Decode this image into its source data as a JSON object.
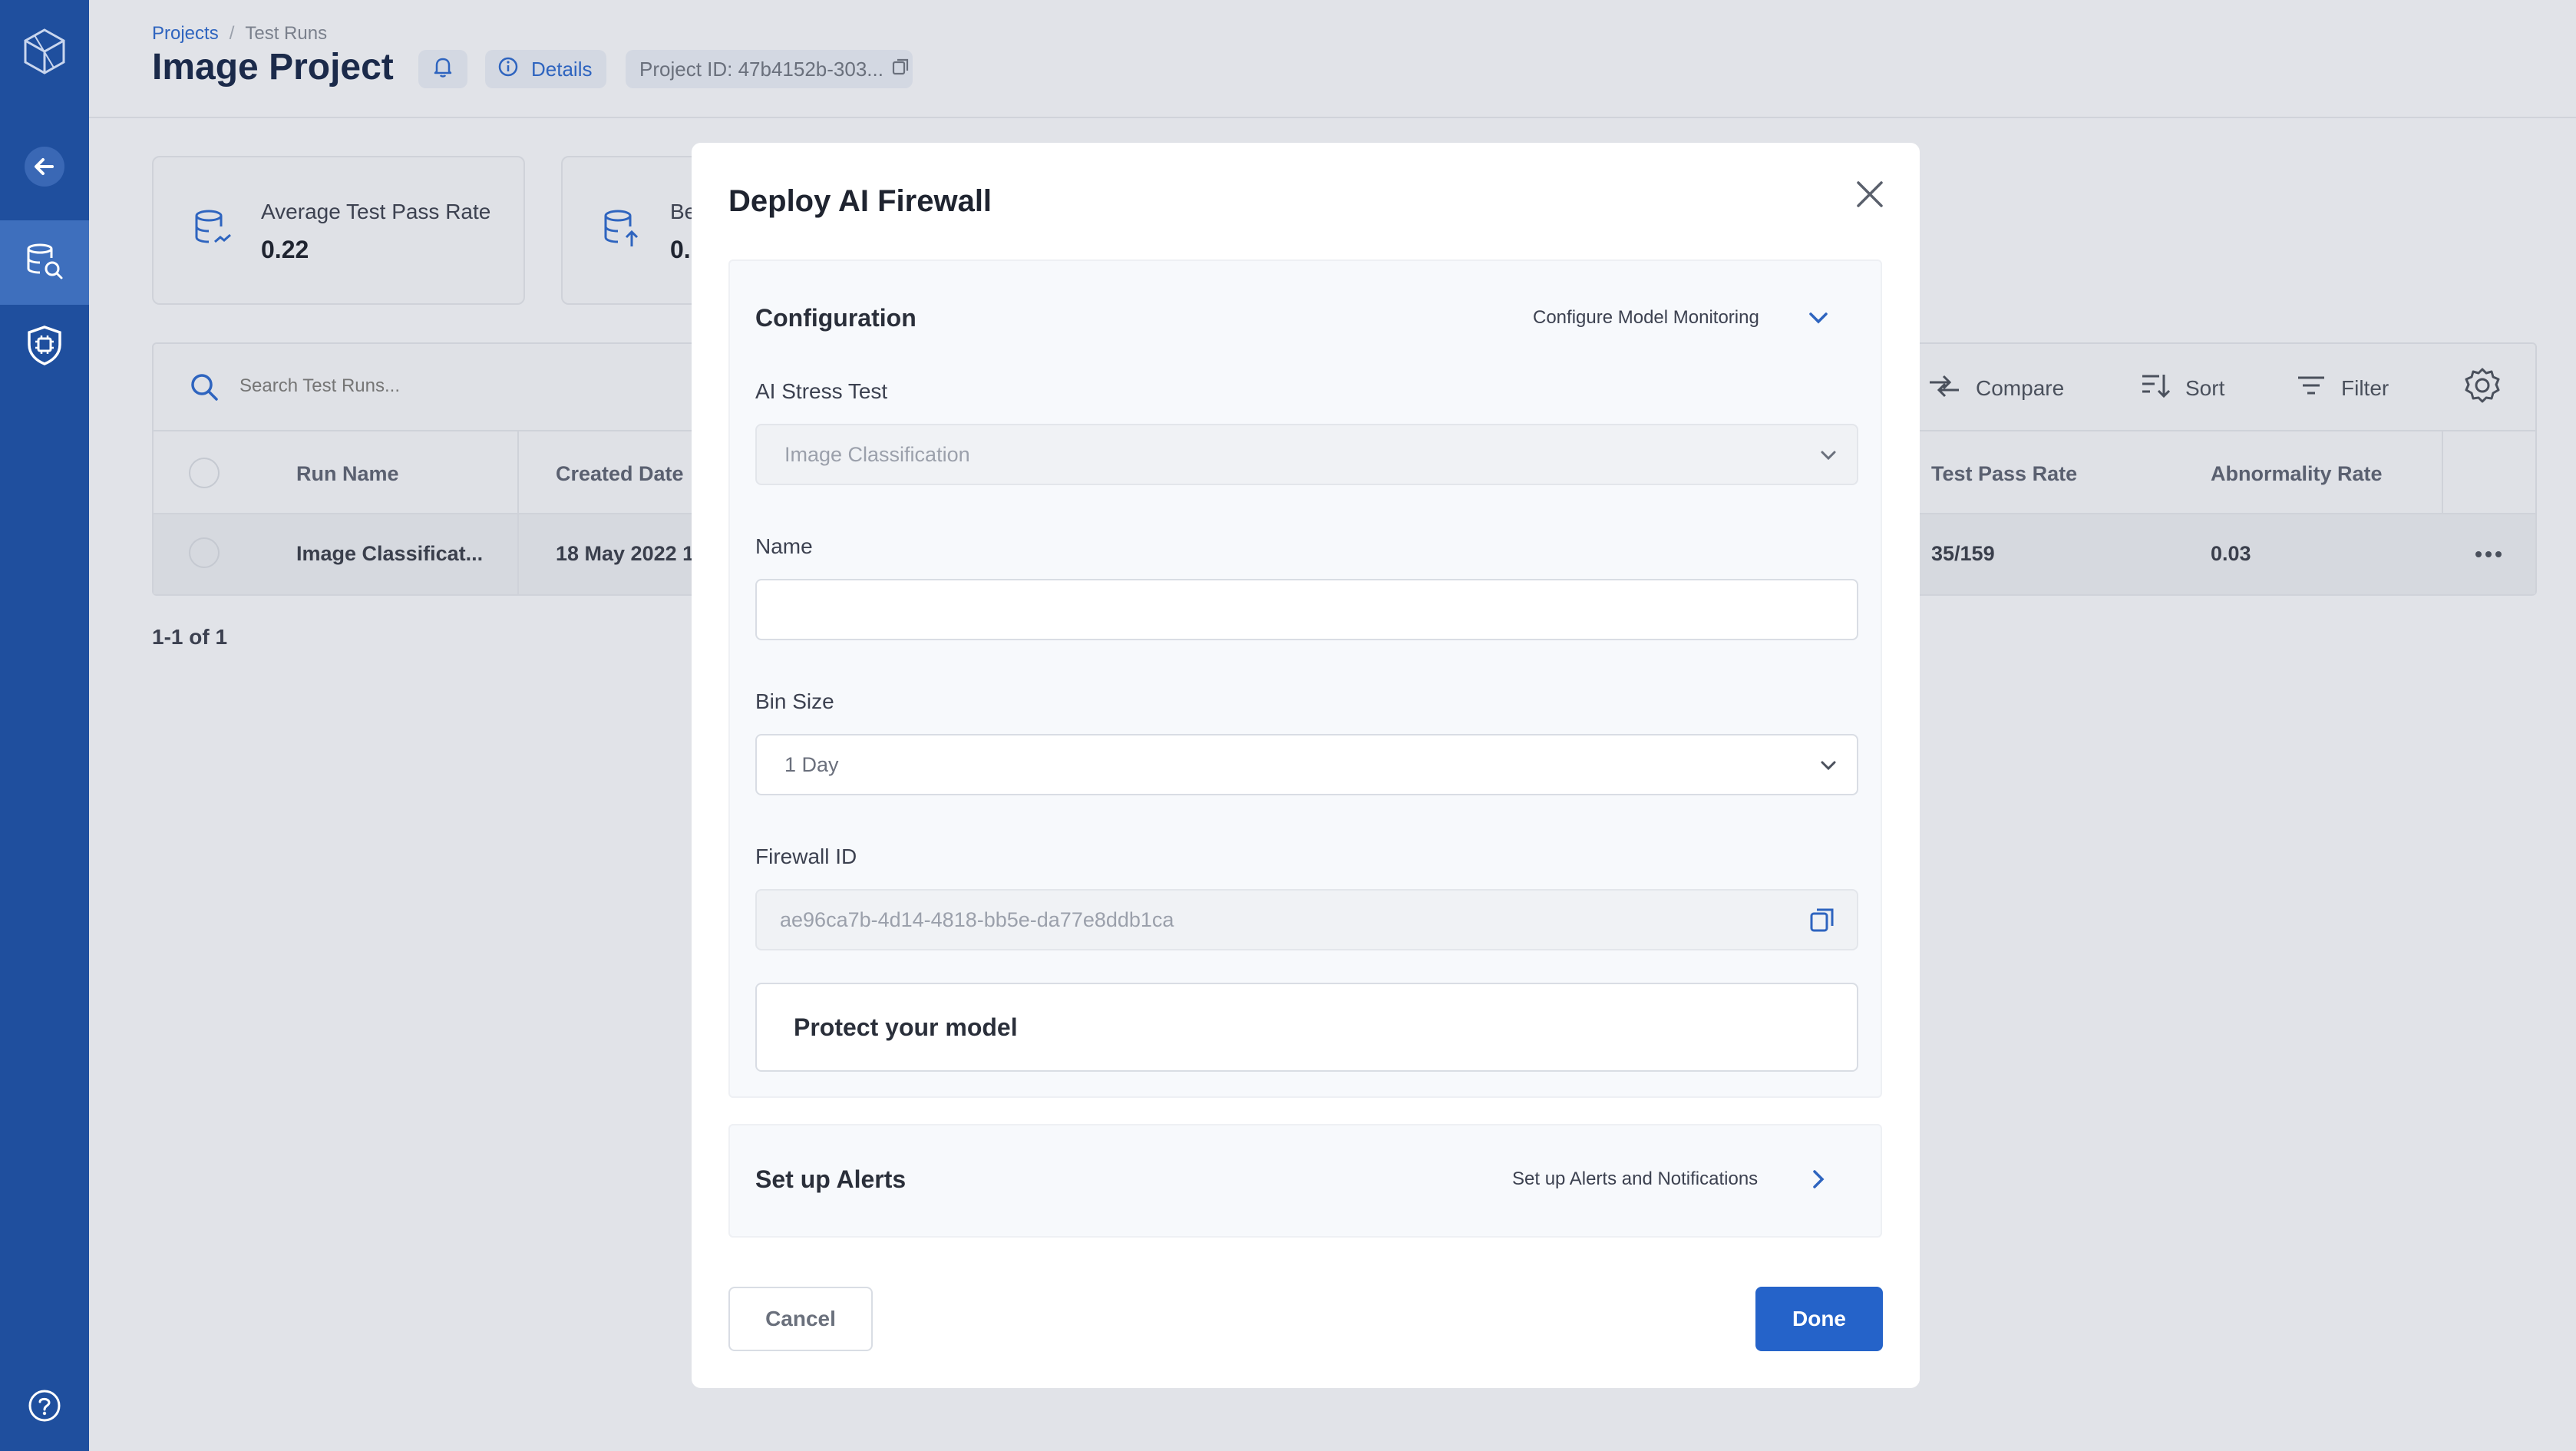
{
  "sidebar": {
    "logo_icon": "hexagon-logo-icon",
    "items": [
      {
        "name": "back",
        "icon": "arrow-left-icon"
      },
      {
        "name": "test-runs",
        "icon": "database-search-icon"
      },
      {
        "name": "firewall",
        "icon": "shield-chip-icon"
      }
    ],
    "help_icon": "help-circle-icon"
  },
  "header": {
    "breadcrumb": {
      "projects": "Projects",
      "separator": "/",
      "current": "Test Runs"
    },
    "title": "Image Project",
    "details_label": "Details",
    "project_id": "Project ID: 47b4152b-303..."
  },
  "stats": [
    {
      "label": "Average Test Pass Rate",
      "value": "0.22"
    },
    {
      "label": "Be",
      "value": "0."
    }
  ],
  "toolbar": {
    "search_placeholder": "Search Test Runs...",
    "compare_label": "Compare",
    "sort_label": "Sort",
    "filter_label": "Filter"
  },
  "table": {
    "columns": [
      "Run Name",
      "Created Date",
      "Test Pass Rate",
      "Abnormality Rate"
    ],
    "rows": [
      {
        "run_name": "Image Classificat...",
        "created_date": "18 May 2022 1",
        "test_pass_rate": "35/159",
        "abnormality_rate": "0.03"
      }
    ],
    "pagination": "1-1 of 1"
  },
  "modal": {
    "title": "Deploy AI Firewall",
    "configuration": {
      "heading": "Configuration",
      "link": "Configure Model Monitoring",
      "stress_test_label": "AI Stress Test",
      "stress_test_value": "Image Classification",
      "name_label": "Name",
      "name_value": "",
      "bin_size_label": "Bin Size",
      "bin_size_value": "1 Day",
      "firewall_id_label": "Firewall ID",
      "firewall_id_value": "ae96ca7b-4d14-4818-bb5e-da77e8ddb1ca",
      "protect_label": "Protect your model"
    },
    "alerts": {
      "heading": "Set up Alerts",
      "link": "Set up Alerts and Notifications"
    },
    "cancel_label": "Cancel",
    "done_label": "Done"
  },
  "colors": {
    "sidebar": "#1f4f9e",
    "accent": "#2563c9",
    "overlay_bg": "#e1e3e8"
  }
}
